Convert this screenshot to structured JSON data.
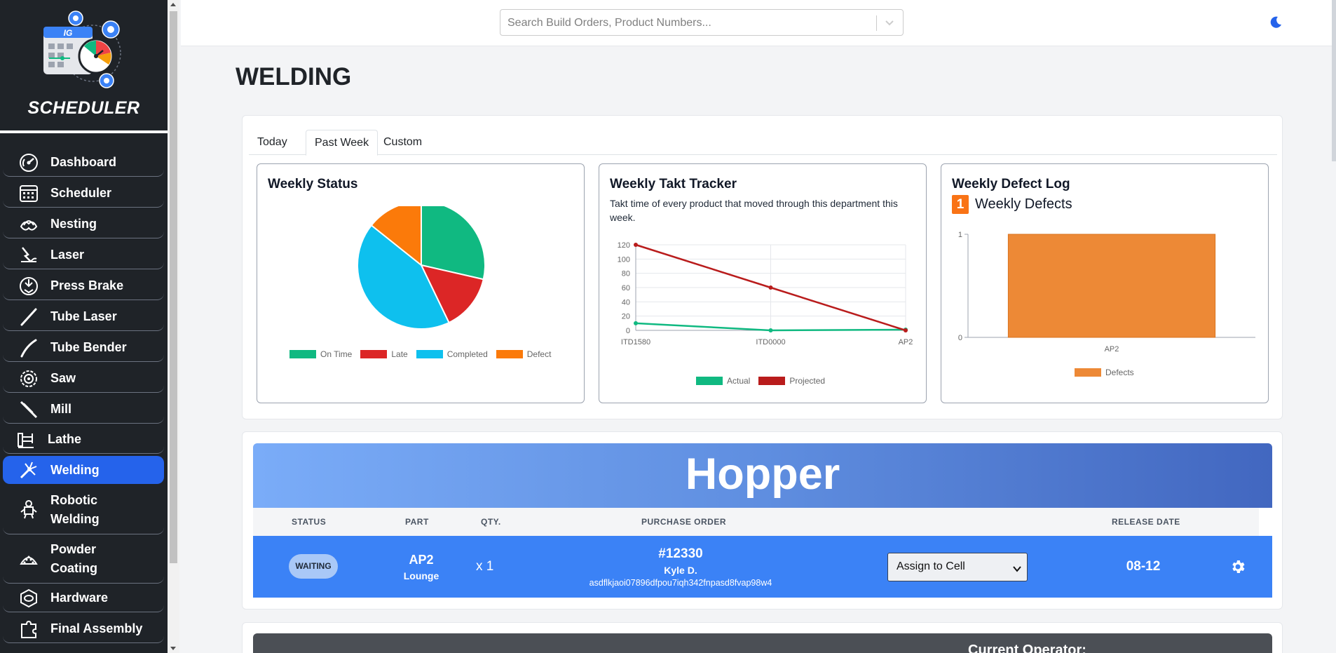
{
  "app": {
    "logo_text": "SCHEDULER",
    "logo_badge": "IG"
  },
  "sidebar": {
    "items": [
      {
        "label": "Dashboard",
        "icon": "gauge-icon"
      },
      {
        "label": "Scheduler",
        "icon": "calendar-grid-icon"
      },
      {
        "label": "Nesting",
        "icon": "nesting-icon"
      },
      {
        "label": "Laser",
        "icon": "laser-icon"
      },
      {
        "label": "Press Brake",
        "icon": "press-brake-icon"
      },
      {
        "label": "Tube Laser",
        "icon": "tube-laser-icon"
      },
      {
        "label": "Tube Bender",
        "icon": "tube-bender-icon"
      },
      {
        "label": "Saw",
        "icon": "saw-blade-icon"
      },
      {
        "label": "Mill",
        "icon": "mill-icon"
      },
      {
        "label": "Lathe",
        "icon": "lathe-icon"
      },
      {
        "label": "Welding",
        "icon": "welding-icon",
        "active": true
      },
      {
        "label": "Robotic Welding",
        "icon": "robot-icon"
      },
      {
        "label": "Powder Coating",
        "icon": "powder-coating-icon"
      },
      {
        "label": "Hardware",
        "icon": "hardware-icon"
      },
      {
        "label": "Final Assembly",
        "icon": "puzzle-icon"
      }
    ]
  },
  "search": {
    "placeholder": "Search Build Orders, Product Numbers..."
  },
  "page": {
    "title": "WELDING"
  },
  "tabs": [
    {
      "label": "Today",
      "active": false
    },
    {
      "label": "Past Week",
      "active": true
    },
    {
      "label": "Custom",
      "active": false
    }
  ],
  "panels": {
    "status": {
      "title": "Weekly Status"
    },
    "takt": {
      "title": "Weekly Takt Tracker",
      "subtitle": "Takt time of every product that moved through this department this week."
    },
    "defect": {
      "title": "Weekly Defect Log",
      "count": "1",
      "count_label": "Weekly Defects"
    }
  },
  "chart_data": [
    {
      "type": "pie",
      "title": "Weekly Status",
      "labels": [
        "On Time",
        "Late",
        "Completed",
        "Defect"
      ],
      "values": [
        3,
        1.5,
        4.5,
        1.5
      ],
      "colors": [
        "#10b981",
        "#dc2626",
        "#0ec0ee",
        "#fb7a0a"
      ]
    },
    {
      "type": "line",
      "title": "Weekly Takt Tracker",
      "x": [
        "ITD1580",
        "ITD0000",
        "AP2"
      ],
      "ylim": [
        0,
        120
      ],
      "yticks": [
        0,
        20,
        40,
        60,
        80,
        100,
        120
      ],
      "series": [
        {
          "name": "Actual",
          "values": [
            10,
            0,
            1
          ],
          "color": "#10b981"
        },
        {
          "name": "Projected",
          "values": [
            120,
            60,
            0
          ],
          "color": "#b91c1c"
        }
      ],
      "grid": true,
      "legend": "bottom"
    },
    {
      "type": "bar",
      "title": "Weekly Defect Log",
      "categories": [
        "AP2"
      ],
      "series": [
        {
          "name": "Defects",
          "values": [
            1
          ],
          "color": "#ed8936"
        }
      ],
      "ylim": [
        0,
        1
      ],
      "yticks": [
        0,
        1
      ],
      "legend": "bottom"
    }
  ],
  "hopper": {
    "title": "Hopper",
    "columns": {
      "status": "STATUS",
      "part": "PART",
      "qty": "QTY.",
      "po": "PURCHASE ORDER",
      "release": "RELEASE DATE"
    },
    "row": {
      "status": "WAITING",
      "part": "AP2",
      "part_sub": "Lounge",
      "qty": "x 1",
      "po_number": "#12330",
      "po_name": "Kyle D.",
      "po_code": "asdflkjaoi07896dfpou7iqh342fnpasd8fvap98w4",
      "assign_label": "Assign to Cell",
      "release_date": "08-12"
    }
  },
  "operator": {
    "label": "Current Operator:"
  }
}
